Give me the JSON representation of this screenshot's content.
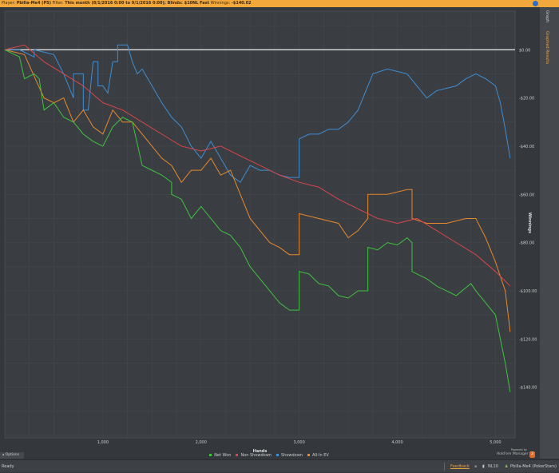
{
  "header": {
    "player_label": "Player:",
    "player": "Pbilla-Me4 (PS)",
    "filter_label": "Filter:",
    "filter": "This month (8/1/2016 0:00 to 9/1/2016 0:00); Blinds: $10NL Fast",
    "winnings_label": "Winnings:",
    "winnings": "-$140.02"
  },
  "side_tabs": [
    "Graph",
    "Graphed Results"
  ],
  "options_label": "Options",
  "brand": {
    "powered": "Powered by",
    "name": "Hold'em Manager",
    "badge": "2"
  },
  "status": {
    "text": "Ready",
    "feedback": "Feedback",
    "table": "NL10",
    "player": "Pbilla-Me4 (PokerStars)"
  },
  "chart_data": {
    "type": "line",
    "xlabel": "Hands",
    "ylabel": "Winnings",
    "xlim": [
      0,
      5200
    ],
    "ylim": [
      -161,
      16
    ],
    "xticks": [
      1000,
      2000,
      3000,
      4000,
      5000
    ],
    "xtick_labels": [
      "1,000",
      "2,000",
      "3,000",
      "4,000",
      "5,000"
    ],
    "yticks": [
      0,
      -20,
      -40,
      -60,
      -80,
      -100,
      -120,
      -140
    ],
    "ytick_labels": [
      "$0.00",
      "-$20.00",
      "-$40.00",
      "-$60.00",
      "-$80.00",
      "-$100.00",
      "-$120.00",
      "-$140.00"
    ],
    "grid": true,
    "legend": "bottom",
    "series": [
      {
        "name": "Net Won",
        "color": "#3ec43e",
        "points": [
          [
            0,
            0
          ],
          [
            150,
            -3
          ],
          [
            200,
            -12
          ],
          [
            300,
            -10
          ],
          [
            350,
            -12
          ],
          [
            400,
            -25
          ],
          [
            500,
            -22
          ],
          [
            600,
            -28
          ],
          [
            700,
            -30
          ],
          [
            800,
            -35
          ],
          [
            900,
            -38
          ],
          [
            1000,
            -40
          ],
          [
            1100,
            -32
          ],
          [
            1200,
            -28
          ],
          [
            1300,
            -30
          ],
          [
            1400,
            -48
          ],
          [
            1500,
            -50
          ],
          [
            1600,
            -52
          ],
          [
            1700,
            -55
          ],
          [
            1700,
            -60
          ],
          [
            1800,
            -62
          ],
          [
            1900,
            -70
          ],
          [
            2000,
            -65
          ],
          [
            2100,
            -70
          ],
          [
            2200,
            -75
          ],
          [
            2300,
            -77
          ],
          [
            2400,
            -82
          ],
          [
            2500,
            -90
          ],
          [
            2600,
            -95
          ],
          [
            2700,
            -100
          ],
          [
            2800,
            -105
          ],
          [
            2900,
            -108
          ],
          [
            3000,
            -108
          ],
          [
            3000,
            -92
          ],
          [
            3100,
            -93
          ],
          [
            3200,
            -97
          ],
          [
            3300,
            -98
          ],
          [
            3400,
            -102
          ],
          [
            3500,
            -103
          ],
          [
            3600,
            -100
          ],
          [
            3700,
            -100
          ],
          [
            3700,
            -82
          ],
          [
            3800,
            -83
          ],
          [
            3900,
            -80
          ],
          [
            4000,
            -81
          ],
          [
            4100,
            -78
          ],
          [
            4150,
            -80
          ],
          [
            4150,
            -92
          ],
          [
            4300,
            -95
          ],
          [
            4400,
            -98
          ],
          [
            4500,
            -100
          ],
          [
            4600,
            -102
          ],
          [
            4750,
            -97
          ],
          [
            4800,
            -100
          ],
          [
            4900,
            -105
          ],
          [
            5000,
            -110
          ],
          [
            5050,
            -120
          ],
          [
            5100,
            -130
          ],
          [
            5150,
            -142
          ]
        ]
      },
      {
        "name": "Non Showdown",
        "color": "#d9464a",
        "points": [
          [
            0,
            0
          ],
          [
            200,
            2
          ],
          [
            400,
            -5
          ],
          [
            600,
            -10
          ],
          [
            800,
            -15
          ],
          [
            1000,
            -22
          ],
          [
            1200,
            -25
          ],
          [
            1400,
            -30
          ],
          [
            1600,
            -35
          ],
          [
            1800,
            -40
          ],
          [
            2000,
            -42
          ],
          [
            2200,
            -40
          ],
          [
            2400,
            -44
          ],
          [
            2600,
            -48
          ],
          [
            2800,
            -52
          ],
          [
            3000,
            -55
          ],
          [
            3200,
            -57
          ],
          [
            3400,
            -62
          ],
          [
            3600,
            -66
          ],
          [
            3800,
            -70
          ],
          [
            4000,
            -72
          ],
          [
            4200,
            -70
          ],
          [
            4400,
            -75
          ],
          [
            4600,
            -80
          ],
          [
            4800,
            -85
          ],
          [
            5000,
            -92
          ],
          [
            5150,
            -98
          ]
        ]
      },
      {
        "name": "Showdown",
        "color": "#3d8fd6",
        "points": [
          [
            0,
            0
          ],
          [
            150,
            0
          ],
          [
            300,
            -3
          ],
          [
            300,
            0
          ],
          [
            500,
            -2
          ],
          [
            600,
            -10
          ],
          [
            700,
            -20
          ],
          [
            700,
            -10
          ],
          [
            800,
            -10
          ],
          [
            800,
            -25
          ],
          [
            850,
            -25
          ],
          [
            900,
            -5
          ],
          [
            950,
            -5
          ],
          [
            950,
            -15
          ],
          [
            1000,
            -15
          ],
          [
            1050,
            -18
          ],
          [
            1100,
            -5
          ],
          [
            1150,
            -5
          ],
          [
            1150,
            2
          ],
          [
            1250,
            2
          ],
          [
            1300,
            -5
          ],
          [
            1350,
            -10
          ],
          [
            1400,
            -8
          ],
          [
            1500,
            -15
          ],
          [
            1600,
            -22
          ],
          [
            1700,
            -28
          ],
          [
            1800,
            -32
          ],
          [
            1900,
            -40
          ],
          [
            2000,
            -45
          ],
          [
            2100,
            -38
          ],
          [
            2200,
            -45
          ],
          [
            2300,
            -52
          ],
          [
            2400,
            -55
          ],
          [
            2500,
            -48
          ],
          [
            2600,
            -50
          ],
          [
            2700,
            -50
          ],
          [
            2800,
            -52
          ],
          [
            2900,
            -53
          ],
          [
            3000,
            -53
          ],
          [
            3000,
            -37
          ],
          [
            3100,
            -35
          ],
          [
            3200,
            -35
          ],
          [
            3300,
            -33
          ],
          [
            3400,
            -33
          ],
          [
            3500,
            -30
          ],
          [
            3600,
            -25
          ],
          [
            3700,
            -15
          ],
          [
            3750,
            -10
          ],
          [
            3900,
            -8
          ],
          [
            4100,
            -10
          ],
          [
            4200,
            -15
          ],
          [
            4300,
            -20
          ],
          [
            4400,
            -17
          ],
          [
            4600,
            -15
          ],
          [
            4700,
            -12
          ],
          [
            4800,
            -10
          ],
          [
            4900,
            -12
          ],
          [
            5000,
            -15
          ],
          [
            5050,
            -22
          ],
          [
            5100,
            -33
          ],
          [
            5150,
            -45
          ]
        ]
      },
      {
        "name": "All-In EV",
        "color": "#e8892c",
        "points": [
          [
            0,
            0
          ],
          [
            200,
            -2
          ],
          [
            400,
            -20
          ],
          [
            500,
            -22
          ],
          [
            600,
            -20
          ],
          [
            700,
            -30
          ],
          [
            800,
            -25
          ],
          [
            900,
            -32
          ],
          [
            1000,
            -35
          ],
          [
            1100,
            -25
          ],
          [
            1200,
            -30
          ],
          [
            1300,
            -30
          ],
          [
            1400,
            -35
          ],
          [
            1500,
            -40
          ],
          [
            1600,
            -45
          ],
          [
            1700,
            -48
          ],
          [
            1800,
            -55
          ],
          [
            1900,
            -50
          ],
          [
            2000,
            -50
          ],
          [
            2100,
            -45
          ],
          [
            2200,
            -52
          ],
          [
            2300,
            -50
          ],
          [
            2400,
            -60
          ],
          [
            2500,
            -70
          ],
          [
            2600,
            -75
          ],
          [
            2700,
            -80
          ],
          [
            2800,
            -82
          ],
          [
            2900,
            -85
          ],
          [
            3000,
            -85
          ],
          [
            3000,
            -68
          ],
          [
            3200,
            -70
          ],
          [
            3400,
            -72
          ],
          [
            3500,
            -78
          ],
          [
            3600,
            -75
          ],
          [
            3700,
            -70
          ],
          [
            3700,
            -60
          ],
          [
            3900,
            -60
          ],
          [
            4100,
            -58
          ],
          [
            4150,
            -58
          ],
          [
            4150,
            -70
          ],
          [
            4300,
            -72
          ],
          [
            4500,
            -72
          ],
          [
            4700,
            -70
          ],
          [
            4800,
            -70
          ],
          [
            4900,
            -78
          ],
          [
            5000,
            -88
          ],
          [
            5100,
            -100
          ],
          [
            5150,
            -117
          ]
        ]
      }
    ]
  }
}
